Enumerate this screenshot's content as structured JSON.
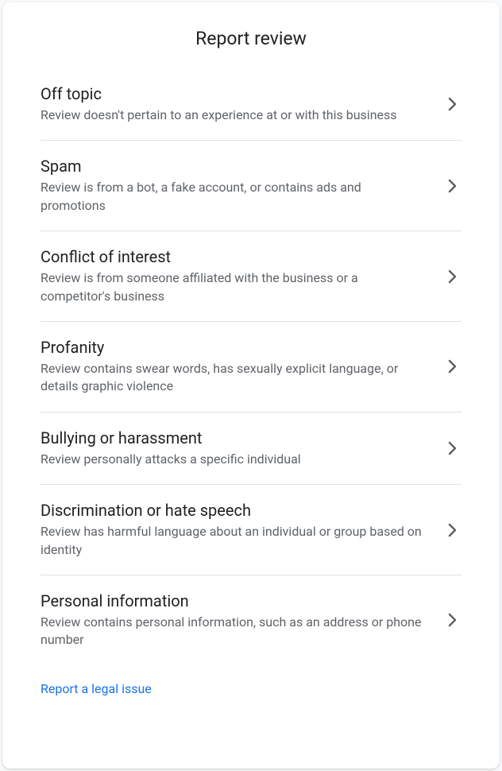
{
  "header": {
    "title": "Report review"
  },
  "options": [
    {
      "title": "Off topic",
      "desc": "Review doesn't pertain to an experience at or with this business"
    },
    {
      "title": "Spam",
      "desc": "Review is from a bot, a fake account, or contains ads and promotions"
    },
    {
      "title": "Conflict of interest",
      "desc": "Review is from someone affiliated with the business or a competitor's business"
    },
    {
      "title": "Profanity",
      "desc": "Review contains swear words, has sexually explicit language, or details graphic violence"
    },
    {
      "title": "Bullying or harassment",
      "desc": "Review personally attacks a specific individual"
    },
    {
      "title": "Discrimination or hate speech",
      "desc": "Review has harmful language about an individual or group based on identity"
    },
    {
      "title": "Personal information",
      "desc": "Review contains personal information, such as an address or phone number"
    }
  ],
  "legal_link": "Report a legal issue"
}
